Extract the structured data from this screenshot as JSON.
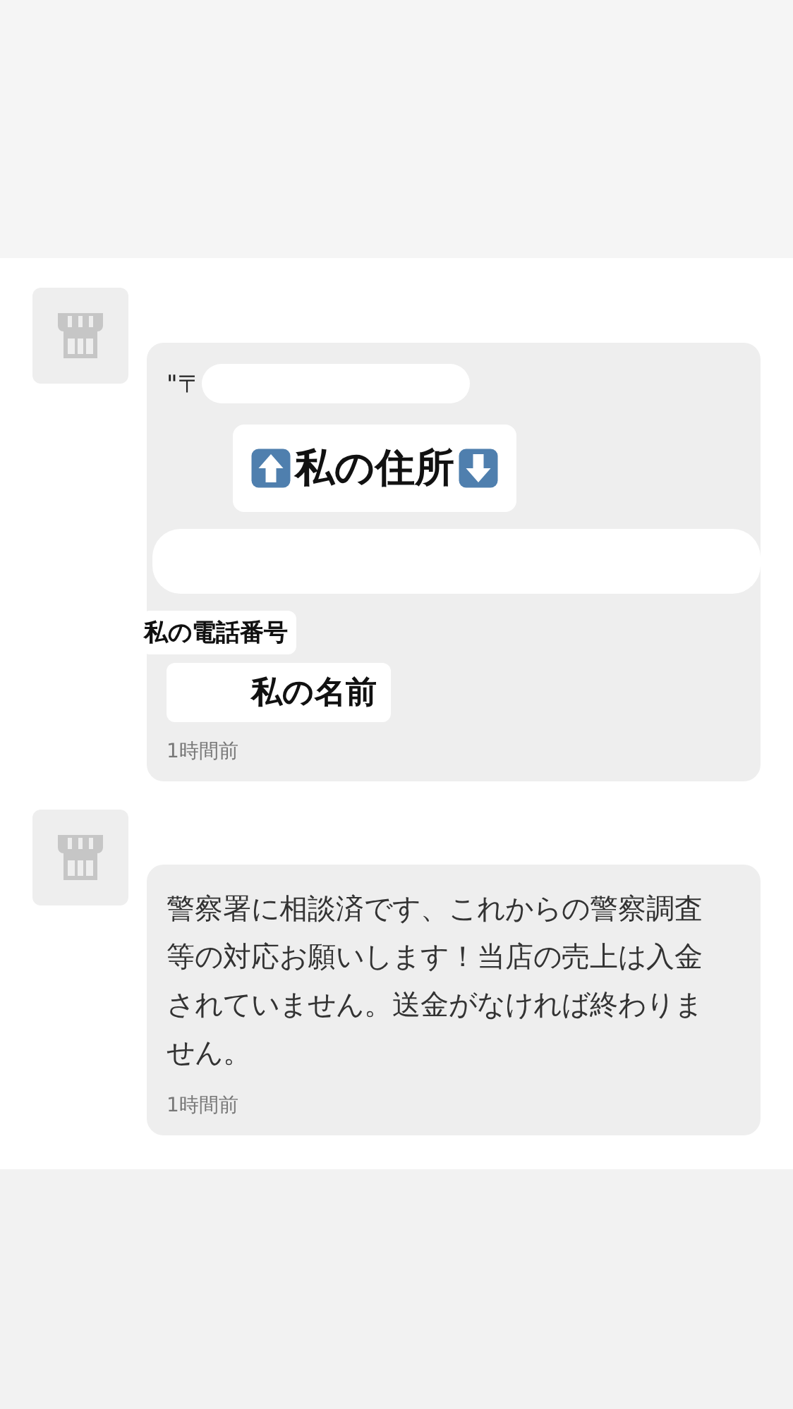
{
  "messages": [
    {
      "kind": "address_card",
      "postal_prefix": "\"〒",
      "address_label": "私の住所",
      "phone_label": "私の電話番号",
      "name_label": "私の名前",
      "time": "1時間前"
    },
    {
      "kind": "text",
      "text": "警察署に相談済です、これからの警察調査等の対応お願いします！当店の売上は入金されていません。送金がなければ終わりません。",
      "time": "1時間前"
    }
  ]
}
